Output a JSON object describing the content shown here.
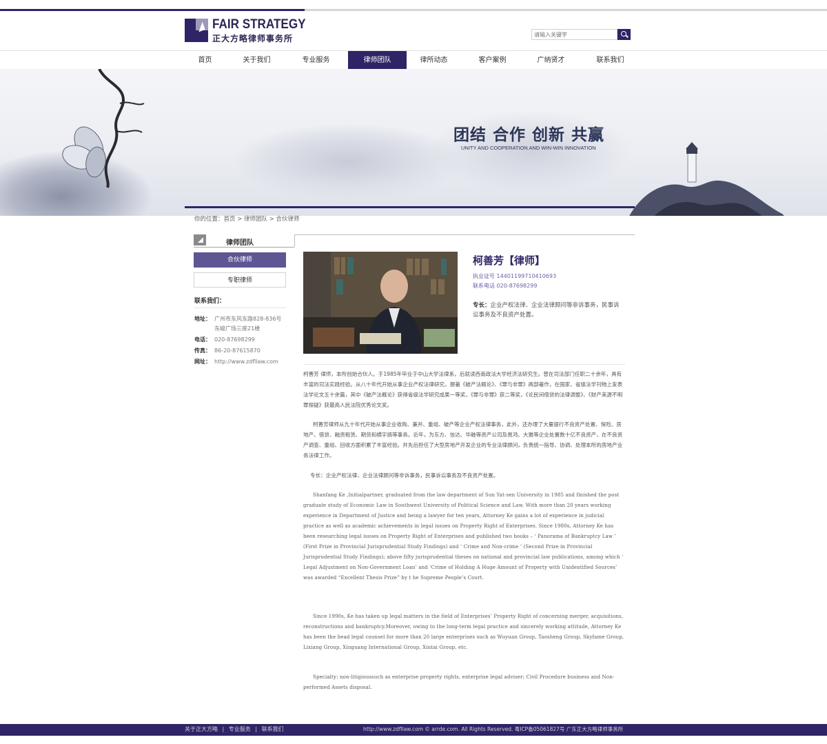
{
  "logo": {
    "en": "FAIR STRATEGY",
    "cn": "正大方略律师事务所"
  },
  "search": {
    "placeholder": "请输入关键字"
  },
  "nav": [
    {
      "label": "首页"
    },
    {
      "label": "关于我们"
    },
    {
      "label": "专业服务"
    },
    {
      "label": "律师团队",
      "active": true
    },
    {
      "label": "律所动态"
    },
    {
      "label": "客户案例"
    },
    {
      "label": "广纳贤才"
    },
    {
      "label": "联系我们"
    }
  ],
  "banner": {
    "title": "团结 合作 创新 共赢",
    "subtitle": "UNITY AND COOPERATION AND WIN-WIN INNOVATION"
  },
  "breadcrumb": "你的位置：首页 > 律师团队 > 合伙律师",
  "sidebar": {
    "heading": "律师团队",
    "buttons": [
      "合伙律师",
      "专职律师"
    ],
    "contact_title": "联系我们：",
    "contact": [
      {
        "k": "地址：",
        "v": "广州市东风东路828-836号东峻广场三座21楼"
      },
      {
        "k": "电话：",
        "v": "020-87698299"
      },
      {
        "k": "传真：",
        "v": "86-20-87615870"
      },
      {
        "k": "网址：",
        "v": "http://www.zdfllaw.com"
      }
    ]
  },
  "lawyer": {
    "name": "柯善芳【律师】",
    "license": "执业证号 14401199710410693",
    "phone": "联系电话 020-87698299",
    "specialty_label": "专长：",
    "specialty": "企业产权法律、企业法律顾问等非诉事务，民事诉讼事务及不良资产处置。"
  },
  "content": {
    "p1": "柯善芳 律师，本所创始合伙人。于1985年毕业于中山大学法律系，后就读西南政法大学经济法研究生。曾在司法部门任职二十余年，具有丰富的司法实践经验。从八十年代开始从事企业产权法律研究，撰著《破产法概论》、《罪与非罪》两部著作，在国家、省级法学刊物上发表法学论文五十余篇，其中《破产法概论》获得省级法学研究成果一等奖，《罪与非罪》获二等奖，《论民间借贷的法律调整》、《财产来源不明罪探疑》获最高人民法院优秀论文奖。",
    "p2": "柯善芳律师从九十年代开始从事企业收购、兼并、重组、破产等企业产权法律事务，此外，还办理了大量银行不良资产处置、保险、房地产、借贷、融资租赁、期货和横宇搞等事务。近年，为东方、信达、华融等资产公司及易鸿、大雅等企业处置数十亿不良资产，在不良资产调查、重组、回收方面积累了丰富经验。并先后担任了大型房地产开发企业的专业法律顾问，负责统一指导、协调、处理本所的房地产业务法律工作。",
    "p3": "专长：企业产权法律、企业法律顾问等非诉事务，民事诉讼事务及不良资产处置。",
    "p4": "Shanfang Ke ,Initialpartner, graduated from the law department of Sun Yat-sen University in 1985 and finished the post graduate study of Economic Law in Southwest University of Political Science and Law. With more than 20 years working experience in Department of Justice and being a lawyer for ten years, Attorney Ke gains a lot of experience in judicial practice as well as academic achievements in legal issues on Property Right of Enterprises. Since 1980s, Attorney Ke has been researching legal issues on Property Right of Enterprises and published two books – ‘ Panorama of Bankruptcy Law ’ (First Prize in Provincial Jurisprudential Study Findings) and ‘ Crime and Non-crime ’ (Second Prize in Provincial Jurisprudential Study Findings); above fifty jurisprudential theses on national and provincial law publications, among which ‘ Legal Adjustment on Non-Government Loan’ and ‘Crime of Holding A Huge Amount of Property with Unidentified Sources’ was awarded “Excellent Thesis Prize” by t he Supreme People’s Court.",
    "p5": "Since 1990s, Ke has taken up legal matters in the field of Enterprises’ Property Right of concerning merger, acquisitions, reconstructions and bankruptcy.Moreover, owing to the long-term legal practice and sincerely working attitude, Attorney Ke has been the head legal counsel for more than 20 large enterprises such as Wuyuan Group, Taosheng Group, Skyfame Group, Lixiang Group, Xinguang International Group, Xintai Group, etc.",
    "p6": "Specialty: non-litigioussuch as enterprise property rights, enterprise legal adviser; Civil Procedure business and Non-performed Assets disposal."
  },
  "footer": {
    "links": [
      "关于正大方略",
      "|",
      "专业服务",
      "|",
      "联系我们"
    ],
    "copyright": "http://www.zdfllaw.com © arrde.com. All Rights Reserved.   粤ICP备05061827号 广东正大方略律师事务所"
  },
  "colors": {
    "brand": "#2f2466",
    "accent_button": "#5d5594",
    "info_text": "#6a62a8"
  }
}
